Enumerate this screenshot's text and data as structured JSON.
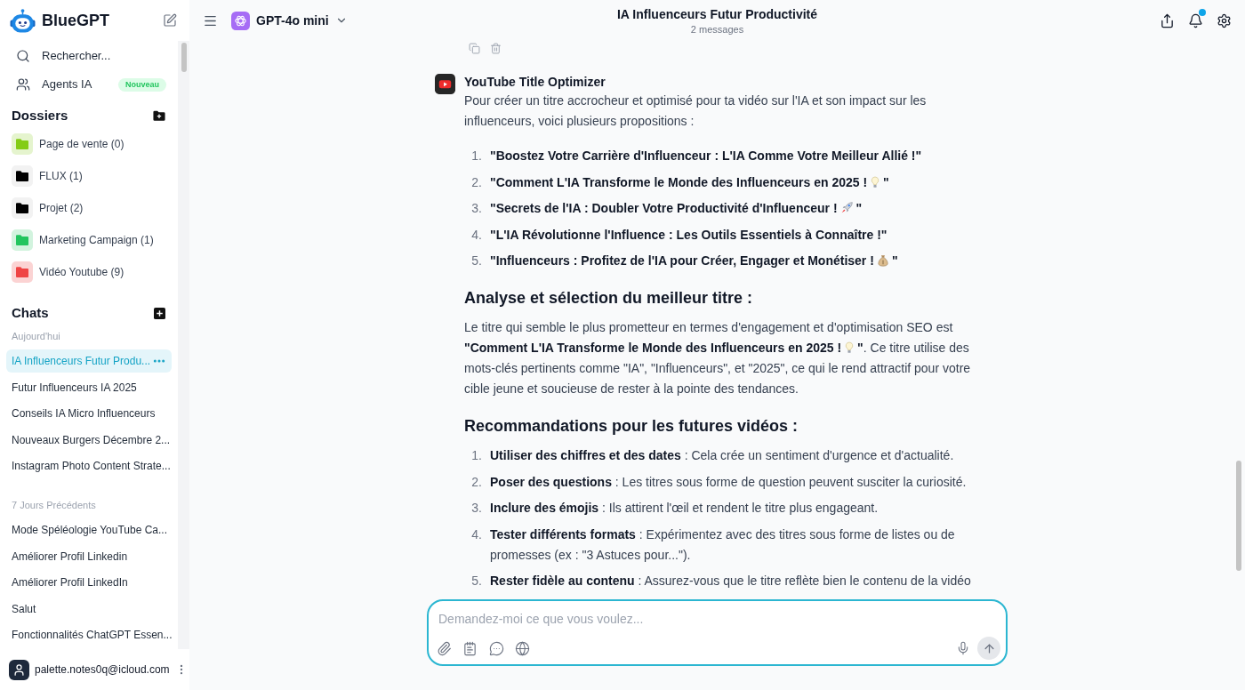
{
  "sidebar": {
    "brand": "BlueGPT",
    "nav": [
      {
        "kind": "search",
        "label": "Rechercher..."
      },
      {
        "kind": "agents",
        "label": "Agents IA",
        "badge": "Nouveau"
      }
    ],
    "folders_heading": "Dossiers",
    "folders": [
      {
        "label": "Page de vente (0)",
        "color": "#84cc16"
      },
      {
        "label": "FLUX (1)",
        "color": "#000000"
      },
      {
        "label": "Projet (2)",
        "color": "#000000"
      },
      {
        "label": "Marketing Campaign (1)",
        "color": "#22c55e"
      },
      {
        "label": "Vidéo Youtube (9)",
        "color": "#ef4444"
      }
    ],
    "chats_heading": "Chats",
    "chat_groups": [
      {
        "label": "Aujourd'hui",
        "chats": [
          {
            "title": "IA Influenceurs Futur Produ...",
            "selected": true
          },
          {
            "title": "Futur Influenceurs IA 2025",
            "selected": false
          },
          {
            "title": "Conseils IA Micro Influenceurs",
            "selected": false
          },
          {
            "title": "Nouveaux Burgers Décembre 2...",
            "selected": false
          },
          {
            "title": "Instagram Photo Content Strate...",
            "selected": false
          }
        ]
      },
      {
        "label": "7 Jours Précédents",
        "chats": [
          {
            "title": "Mode Spéléologie YouTube Ca...",
            "selected": false
          },
          {
            "title": "Améliorer Profil Linkedin",
            "selected": false
          },
          {
            "title": "Améliorer Profil LinkedIn",
            "selected": false
          },
          {
            "title": "Salut",
            "selected": false
          },
          {
            "title": "Fonctionnalités ChatGPT Essen...",
            "selected": false
          }
        ]
      }
    ],
    "user": {
      "email": "palette.notes0q@icloud.com"
    }
  },
  "topbar": {
    "model": "GPT-4o mini",
    "title": "IA Influenceurs Futur Productivité",
    "subtitle": "2 messages",
    "notification_unread": true
  },
  "message": {
    "author": "YouTube Title Optimizer",
    "intro": "Pour créer un titre accrocheur et optimisé pour ta vidéo sur l'IA et son impact sur les influenceurs, voici plusieurs propositions :",
    "titles": [
      {
        "marker": "1.",
        "kind": "plain",
        "text": "\"Boostez Votre Carrière d'Influenceur : L'IA Comme Votre Meilleur Allié !\""
      },
      {
        "marker": "2.",
        "kind": "bulb",
        "text": "\"Comment L'IA Transforme le Monde des Influenceurs en 2025 !",
        "after": "\""
      },
      {
        "marker": "3.",
        "kind": "rocket",
        "text": "\"Secrets de l'IA : Doubler Votre Productivité d'Influenceur !",
        "after": "\""
      },
      {
        "marker": "4.",
        "kind": "plain",
        "text": "\"L'IA Révolutionne l'Influence : Les Outils Essentiels à Connaître !\""
      },
      {
        "marker": "5.",
        "kind": "moneybag",
        "text": "\"Influenceurs : Profitez de l'IA pour Créer, Engager et Monétiser !",
        "after": "\""
      }
    ],
    "analysis": {
      "heading": "Analyse et sélection du meilleur titre :",
      "before": "Le titre qui semble le plus prometteur en termes d'engagement et d'optimisation SEO est **\"Comment L'IA Transforme le Monde des Influenceurs en 2025 !**",
      "kind": "bulb",
      "after": "**\"**. Ce titre utilise des mots-clés pertinents comme \"IA\", \"Influenceurs\", et \"2025\", ce qui le rend attractif pour votre cible jeune et soucieuse de rester à la pointe des tendances."
    },
    "recommendations": {
      "heading": "Recommandations pour les futures vidéos :",
      "items": [
        {
          "marker": "1.",
          "text": "**Utiliser des chiffres et des dates** : Cela crée un sentiment d'urgence et d'actualité."
        },
        {
          "marker": "2.",
          "text": "**Poser des questions** : Les titres sous forme de question peuvent susciter la curiosité."
        },
        {
          "marker": "3.",
          "text": "**Inclure des émojis** : Ils attirent l'œil et rendent le titre plus engageant."
        },
        {
          "marker": "4.",
          "text": "**Tester différents formats** : Expérimentez avec des titres sous forme de listes ou de promesses (ex : \"3 Astuces pour...\")."
        },
        {
          "marker": "5.",
          "text": "**Rester fidèle au contenu** : Assurez-vous que le titre reflète bien le contenu de la vidéo"
        }
      ]
    }
  },
  "composer": {
    "placeholder": "Demandez-moi ce que vous voulez..."
  }
}
